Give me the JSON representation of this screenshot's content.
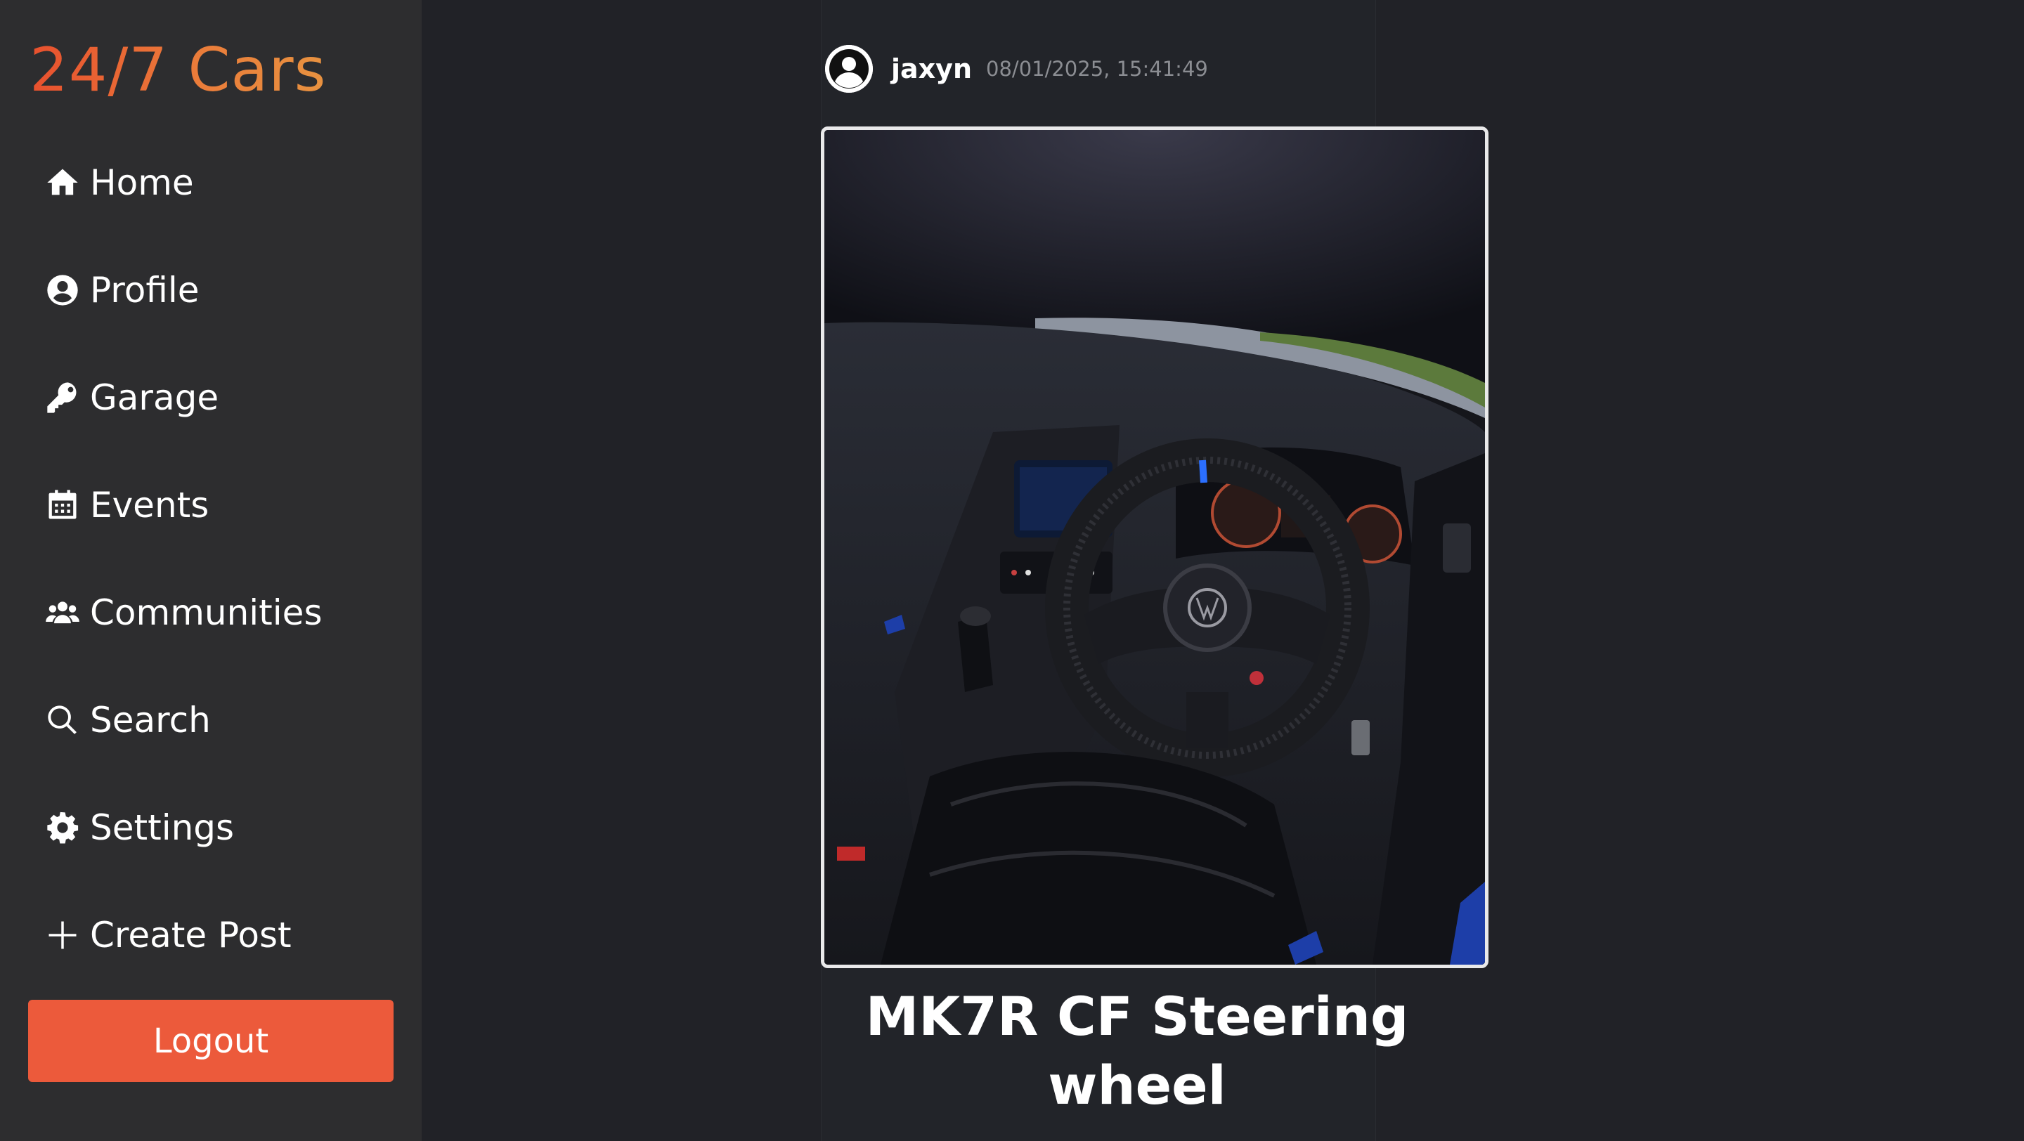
{
  "app": {
    "brand": "24/7 Cars"
  },
  "sidebar": {
    "items": [
      {
        "label": "Home",
        "icon": "home-icon"
      },
      {
        "label": "Profile",
        "icon": "user-circle-icon"
      },
      {
        "label": "Garage",
        "icon": "key-icon"
      },
      {
        "label": "Events",
        "icon": "calendar-icon"
      },
      {
        "label": "Communities",
        "icon": "users-icon"
      },
      {
        "label": "Search",
        "icon": "search-icon"
      },
      {
        "label": "Settings",
        "icon": "gear-icon"
      },
      {
        "label": "Create Post",
        "icon": "plus-icon"
      }
    ],
    "logout_label": "Logout"
  },
  "post": {
    "username": "jaxyn",
    "timestamp": "08/01/2025, 15:41:49",
    "title": "MK7R CF Steering wheel",
    "image_icon": "steering-wheel-photo"
  },
  "colors": {
    "brand_start": "#e8502e",
    "brand_end": "#e89240",
    "logout": "#ec5a3b",
    "sidebar_bg": "#2d2d2f",
    "page_bg": "#212227"
  }
}
